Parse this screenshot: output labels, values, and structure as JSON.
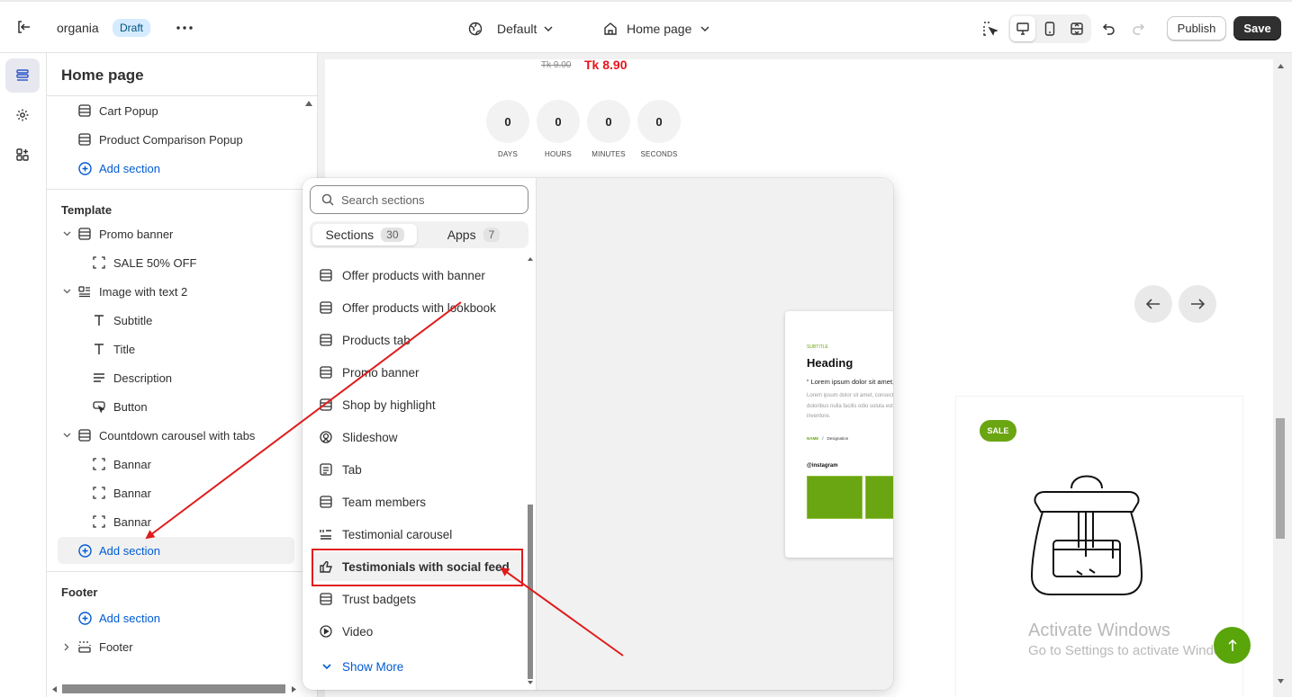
{
  "topbar": {
    "store_name": "organia",
    "status_badge": "Draft",
    "theme_selector": "Default",
    "page_selector": "Home page",
    "publish_label": "Publish",
    "save_label": "Save"
  },
  "rail": {
    "items": [
      "sections-icon",
      "settings-icon",
      "apps-icon"
    ]
  },
  "sidebar": {
    "title": "Home page",
    "header_group": [
      {
        "label": "Cart Popup",
        "icon": "section-icon"
      },
      {
        "label": "Product Comparison Popup",
        "icon": "section-icon"
      },
      {
        "label": "Add section",
        "icon": "plus-circle-icon"
      }
    ],
    "template": {
      "heading": "Template",
      "sections": [
        {
          "label": "Promo banner",
          "icon": "section-icon",
          "blocks": [
            {
              "label": "SALE 50% OFF",
              "icon": "block-icon"
            }
          ]
        },
        {
          "label": "Image with text 2",
          "icon": "image-text-icon",
          "blocks": [
            {
              "label": "Subtitle",
              "icon": "text-icon"
            },
            {
              "label": "Title",
              "icon": "text-icon"
            },
            {
              "label": "Description",
              "icon": "paragraph-icon"
            },
            {
              "label": "Button",
              "icon": "button-icon"
            }
          ]
        },
        {
          "label": "Countdown carousel with tabs",
          "icon": "section-icon",
          "blocks": [
            {
              "label": "Bannar",
              "icon": "block-icon"
            },
            {
              "label": "Bannar",
              "icon": "block-icon"
            },
            {
              "label": "Bannar",
              "icon": "block-icon"
            }
          ]
        }
      ],
      "add_label": "Add section"
    },
    "footer": {
      "heading": "Footer",
      "add_label": "Add section",
      "section_label": "Footer"
    }
  },
  "preview": {
    "old_price": "Tk 9.00",
    "new_price": "Tk 8.90",
    "countdown": [
      {
        "value": "0",
        "label": "DAYS"
      },
      {
        "value": "0",
        "label": "HOURS"
      },
      {
        "value": "0",
        "label": "MINUTES"
      },
      {
        "value": "0",
        "label": "SECONDS"
      }
    ],
    "sale_badge": "SALE",
    "watermark_title": "Activate Windows",
    "watermark_sub": "Go to Settings to activate Windows."
  },
  "popover": {
    "search_placeholder": "Search sections",
    "tabs": [
      {
        "label": "Sections",
        "count": "30"
      },
      {
        "label": "Apps",
        "count": "7"
      }
    ],
    "items": [
      {
        "label": "Offer products with banner",
        "icon": "section-icon"
      },
      {
        "label": "Offer products with lookbook",
        "icon": "section-icon"
      },
      {
        "label": "Products tab",
        "icon": "section-icon"
      },
      {
        "label": "Promo banner",
        "icon": "section-icon"
      },
      {
        "label": "Shop by highlight",
        "icon": "section-icon"
      },
      {
        "label": "Slideshow",
        "icon": "slideshow-icon"
      },
      {
        "label": "Tab",
        "icon": "tab-icon"
      },
      {
        "label": "Team members",
        "icon": "section-icon"
      },
      {
        "label": "Testimonial carousel",
        "icon": "list-icon"
      },
      {
        "label": "Testimonials with social feed",
        "icon": "thumbs-up-icon"
      },
      {
        "label": "Trust badgets",
        "icon": "section-icon"
      },
      {
        "label": "Video",
        "icon": "play-icon"
      }
    ],
    "show_more": "Show More",
    "preview_card": {
      "subtitle": "SUBTITLE",
      "heading": "Heading",
      "quote": "“ Lorem ipsum dolor sit amet, consectetur adipisicing elit. Voluptate aut, quibusdam velit “",
      "body": "Lorem ipsum dolor sit amet, consectetur adipisicing elit. Voluptate aut, quibusdam velit nesciunt dignissimos doloribus nulla facilis odio soluta est harum consectetur et blanditiis adipisci aspernatur impedit itaque quis inventore.",
      "name": "NAME",
      "designation": "Designation",
      "instagram": "@instagram"
    }
  },
  "colors": {
    "accent_blue": "#005bd3",
    "annotation_red": "#e01b1b",
    "price_red": "#e8141b",
    "green": "#6aa512"
  }
}
